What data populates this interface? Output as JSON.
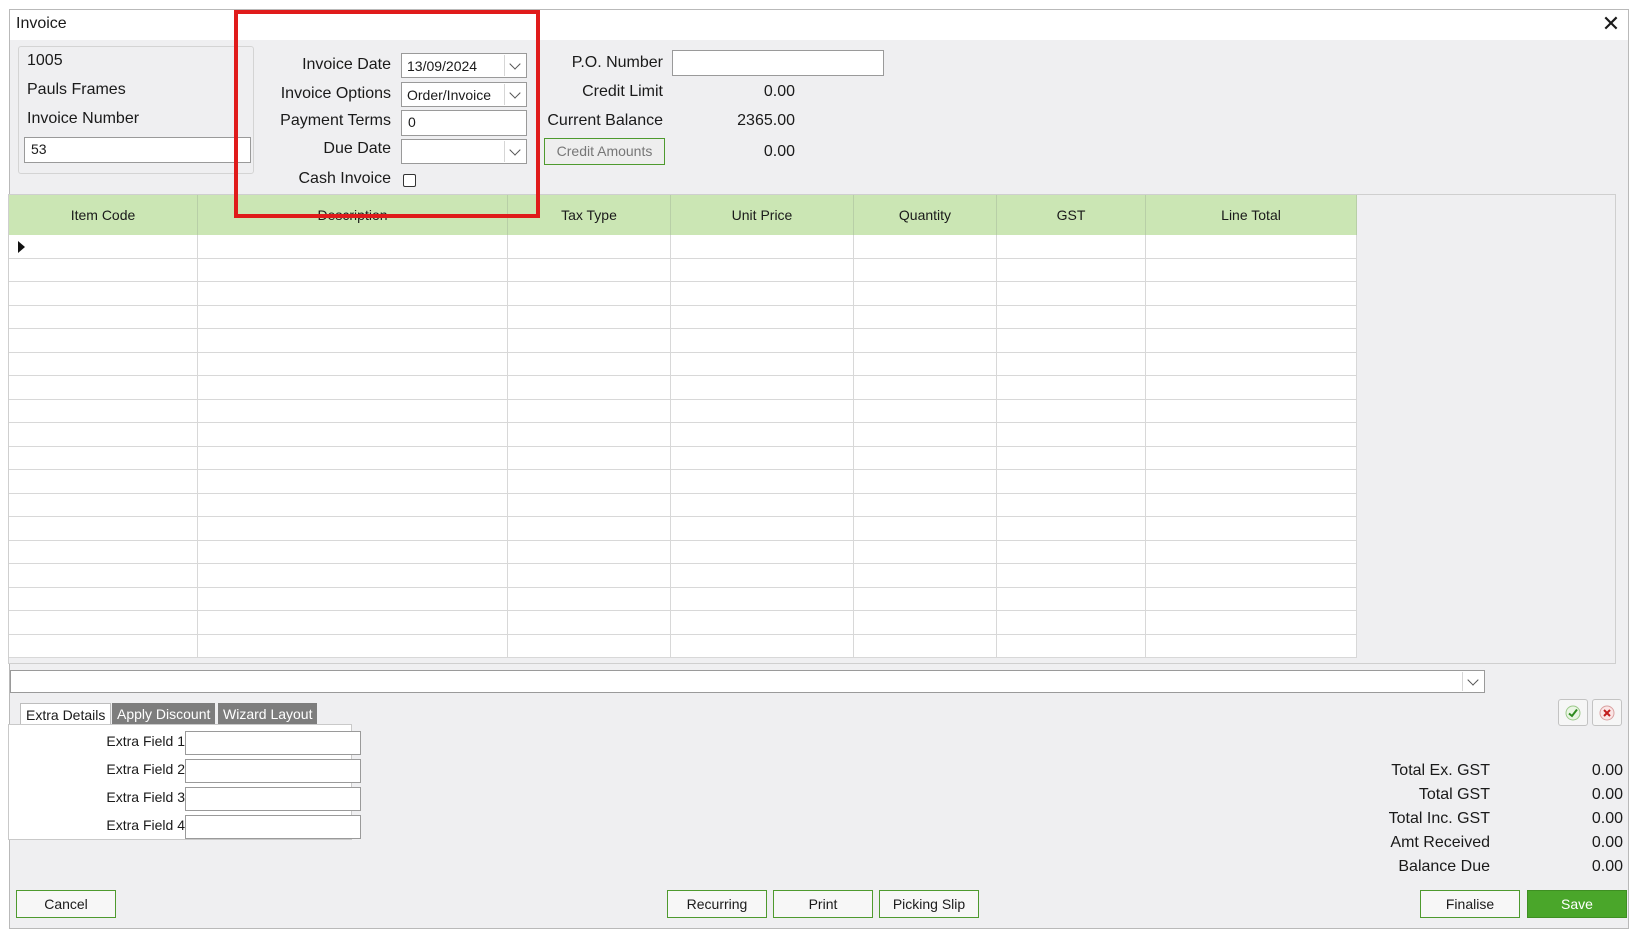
{
  "window": {
    "title": "Invoice",
    "close_symbol": "✕"
  },
  "customer": {
    "code": "1005",
    "name": "Pauls Frames",
    "invoice_number_label": "Invoice Number",
    "invoice_number_value": "53"
  },
  "invoice_fields": {
    "invoice_date_label": "Invoice Date",
    "invoice_date_value": "13/09/2024",
    "invoice_options_label": "Invoice Options",
    "invoice_options_value": "Order/Invoice",
    "payment_terms_label": "Payment Terms",
    "payment_terms_value": "0",
    "due_date_label": "Due Date",
    "due_date_value": "",
    "cash_invoice_label": "Cash Invoice",
    "cash_invoice_checked": false
  },
  "account": {
    "po_number_label": "P.O. Number",
    "po_number_value": "",
    "credit_limit_label": "Credit Limit",
    "credit_limit_value": "0.00",
    "current_balance_label": "Current Balance",
    "current_balance_value": "2365.00",
    "credit_amounts_button": "Credit Amounts",
    "credit_amounts_value": "0.00"
  },
  "grid": {
    "columns": [
      "Item Code",
      "Description",
      "Tax Type",
      "Unit Price",
      "Quantity",
      "GST",
      "Line Total"
    ],
    "header_color": "#cbe6b4"
  },
  "tabs": {
    "items": [
      "Extra Details",
      "Apply Discount",
      "Wizard Layout"
    ],
    "active": "Extra Details"
  },
  "extra_fields": [
    {
      "label": "Extra Field 1",
      "value": ""
    },
    {
      "label": "Extra Field 2",
      "value": ""
    },
    {
      "label": "Extra Field 3",
      "value": ""
    },
    {
      "label": "Extra Field 4",
      "value": ""
    }
  ],
  "totals": [
    {
      "label": "Total Ex. GST",
      "value": "0.00"
    },
    {
      "label": "Total GST",
      "value": "0.00"
    },
    {
      "label": "Total Inc. GST",
      "value": "0.00"
    },
    {
      "label": "Amt Received",
      "value": "0.00"
    },
    {
      "label": "Balance Due",
      "value": "0.00"
    }
  ],
  "buttons": {
    "cancel": "Cancel",
    "recurring": "Recurring",
    "print": "Print",
    "picking_slip": "Picking Slip",
    "finalise": "Finalise",
    "save": "Save"
  },
  "colors": {
    "accent_green": "#4aa62a",
    "highlight_red": "#e01b1b"
  }
}
